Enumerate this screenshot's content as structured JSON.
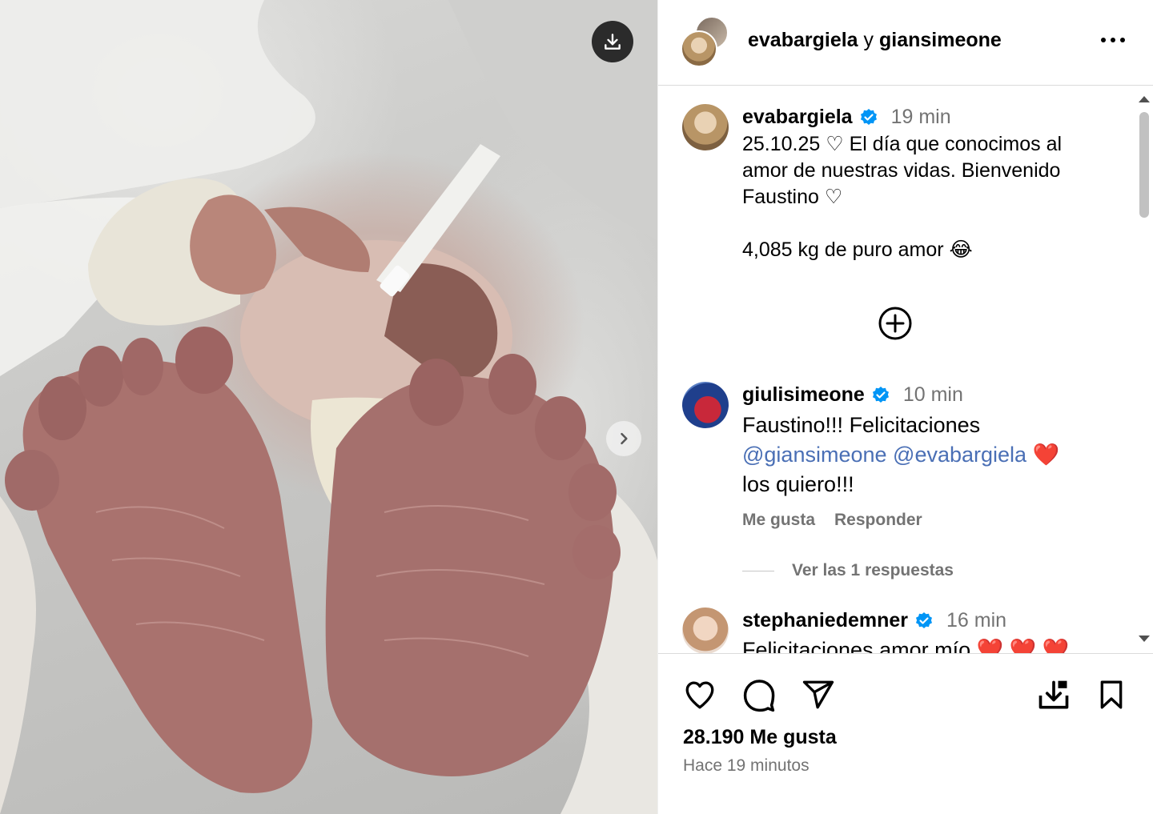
{
  "header": {
    "user1": "evabargiela",
    "connector": "y",
    "user2": "giansimeone"
  },
  "post": {
    "author": "evabargiela",
    "time": "19 min",
    "caption_lines": [
      "25.10.25 ♡ El día que conocimos al",
      "amor de nuestras vidas. Bienvenido",
      "Faustino ♡",
      "",
      "4,085 kg de puro amor 😂"
    ]
  },
  "comments": [
    {
      "user": "giulisimeone",
      "time": "10 min",
      "line1": "Faustino!!! Felicitaciones",
      "mention1": "@giansimeone",
      "mention2": "@evabargiela",
      "emoji": "❤️",
      "line3": "los quiero!!!",
      "like_label": "Me gusta",
      "reply_label": "Responder",
      "replies_label": "Ver las 1 respuestas"
    },
    {
      "user": "stephaniedemner",
      "time": "16 min",
      "line1": "Felicitaciones amor mío ❤️ ❤️ ❤️"
    }
  ],
  "footer": {
    "likes": "28.190 Me gusta",
    "posted": "Hace 19 minutos"
  },
  "icons": {
    "download": "download-icon",
    "next": "chevron-right-icon",
    "more": "more-options-icon",
    "add": "add-circle-icon",
    "like": "heart-icon",
    "comment": "comment-icon",
    "share": "send-icon",
    "save_download": "save-download-icon",
    "bookmark": "bookmark-icon",
    "verified": "verified-badge-icon"
  },
  "colors": {
    "verified": "#0095f6",
    "mention": "#4a6fb5",
    "secondary_text": "#737373",
    "heart_red": "#e0202e"
  }
}
